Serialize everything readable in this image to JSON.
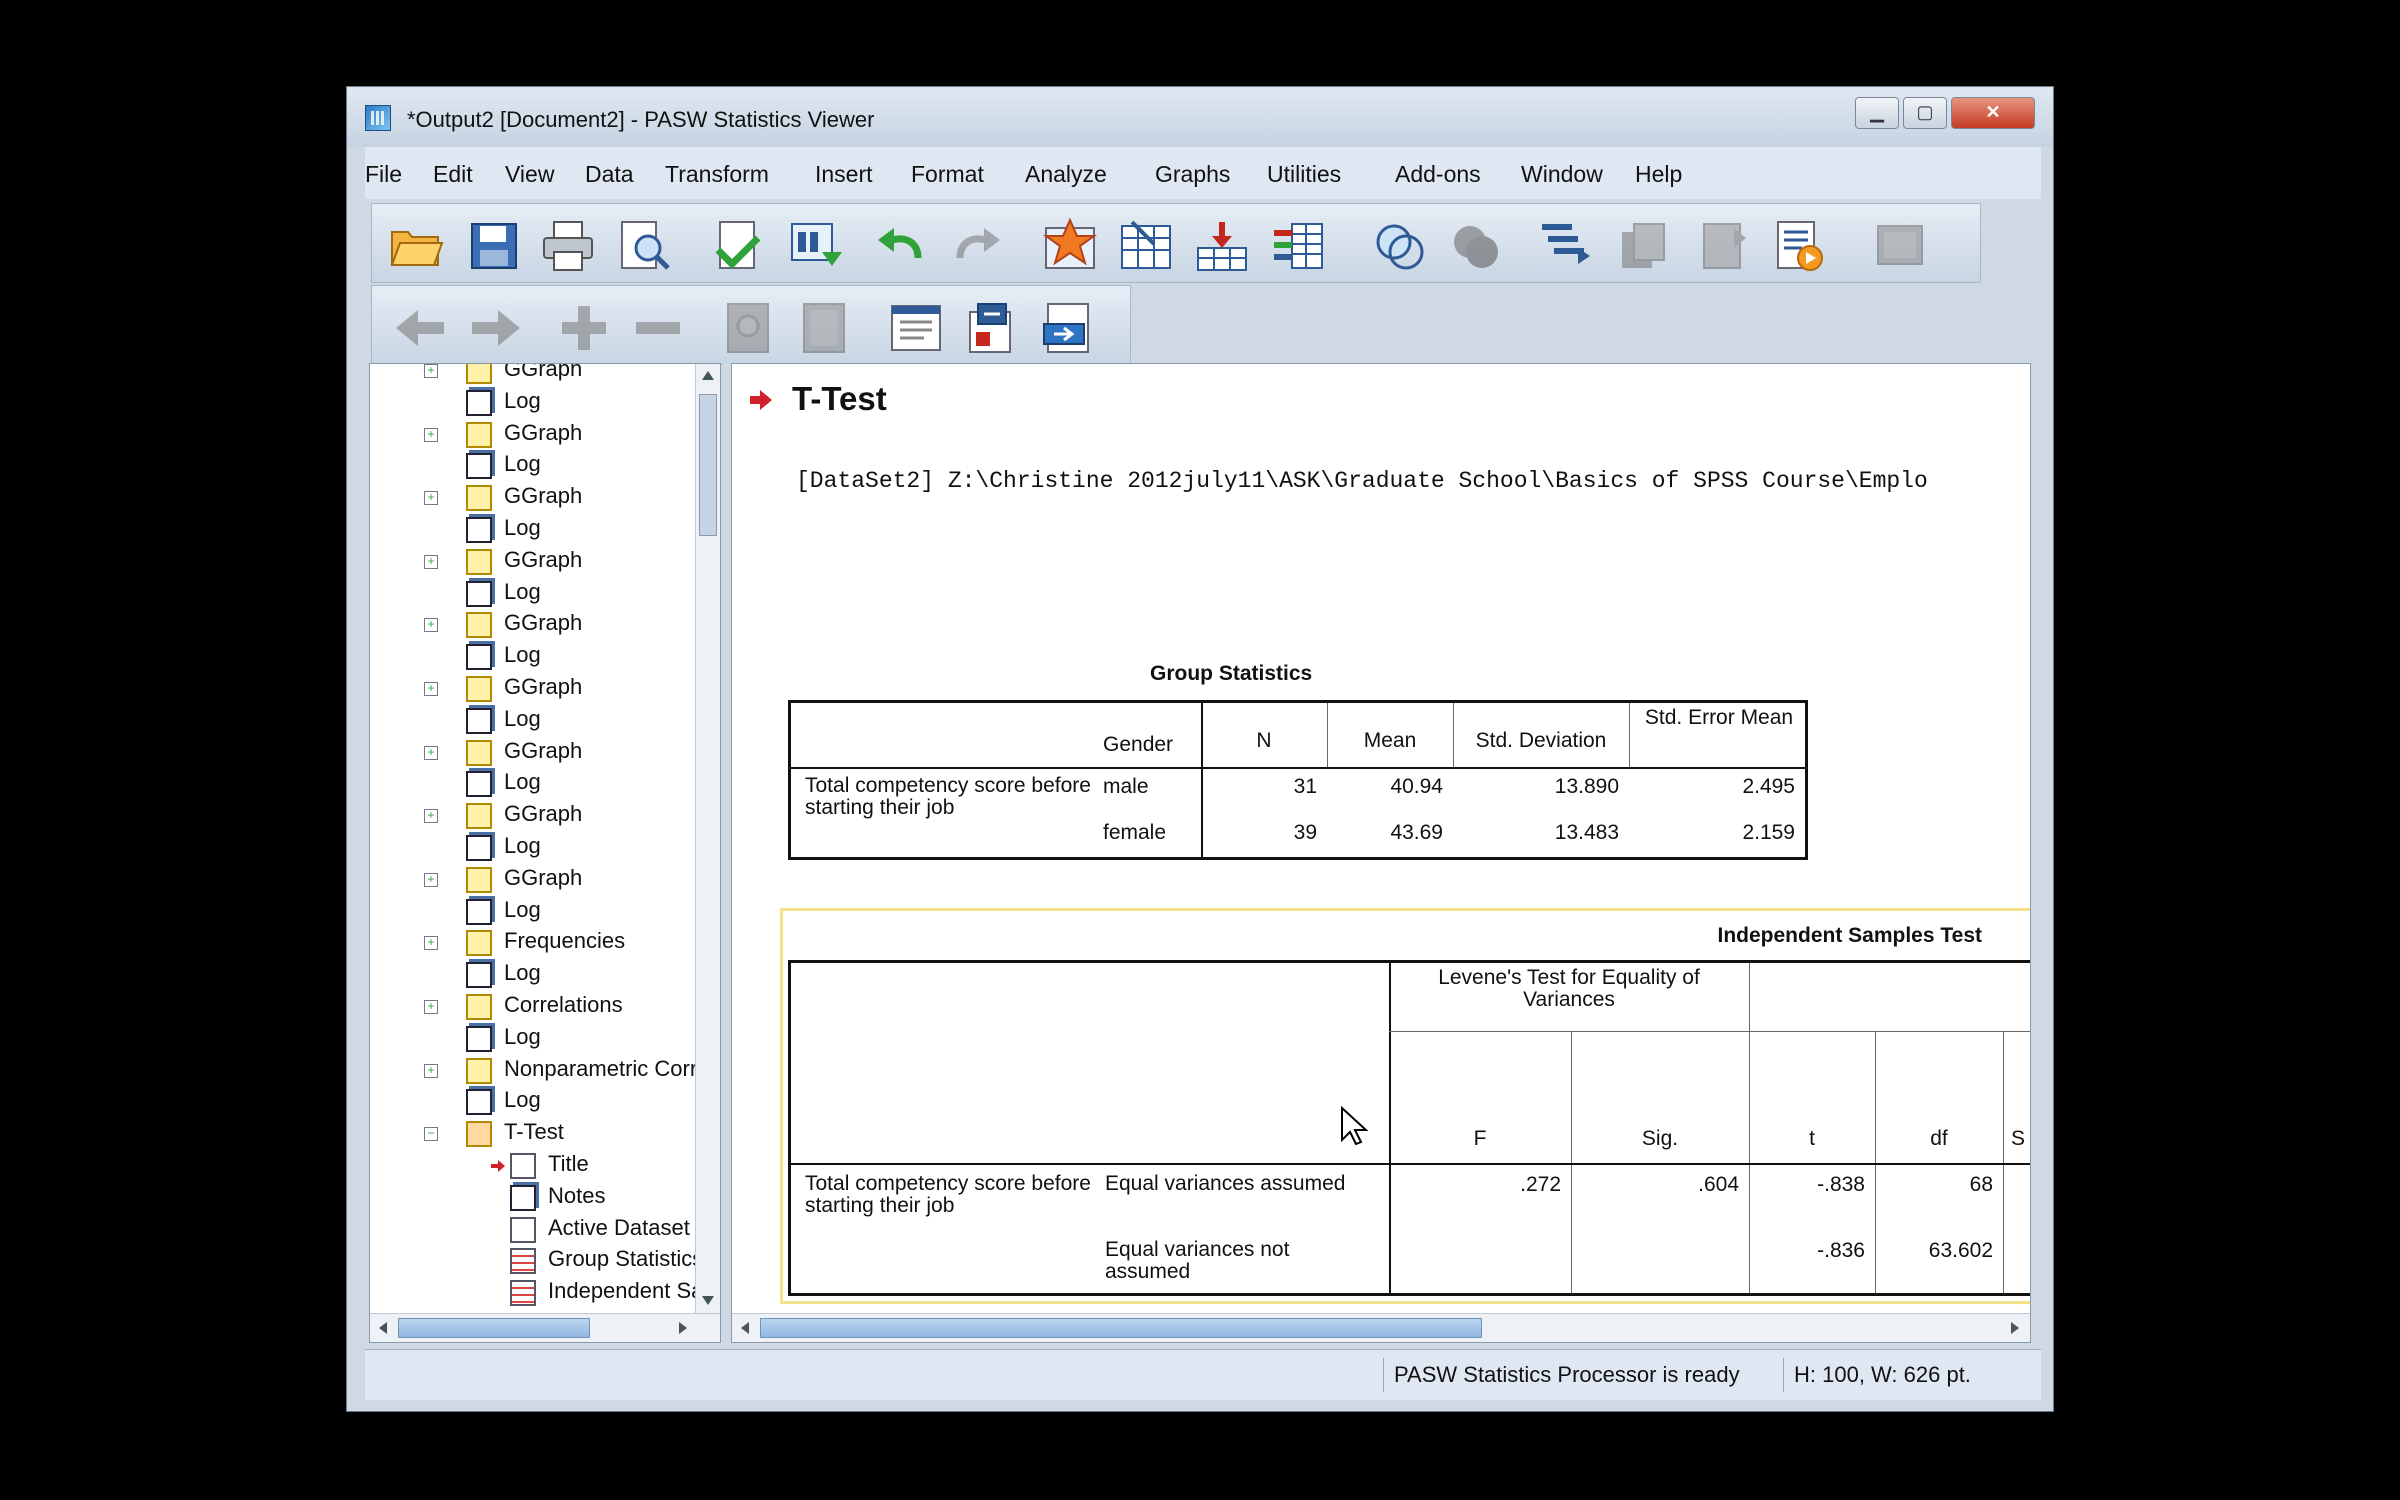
{
  "window": {
    "title": "*Output2 [Document2] - PASW Statistics Viewer"
  },
  "titlebar_buttons": {
    "minimize": "▁",
    "maximize": "▢",
    "close": "✕"
  },
  "menu": [
    "File",
    "Edit",
    "View",
    "Data",
    "Transform",
    "Insert",
    "Format",
    "Analyze",
    "Graphs",
    "Utilities",
    "Add-ons",
    "Window",
    "Help"
  ],
  "toolbar1_icons": [
    "open-icon",
    "save-icon",
    "print-icon",
    "print-preview-icon",
    "export-icon",
    "recall-dialog-icon",
    "undo-icon",
    "redo-icon",
    "goto-case-icon",
    "goto-variable-icon",
    "insert-cases-icon",
    "variables-icon",
    "select-cases-icon",
    "weight-cases-icon",
    "split-file-icon",
    "value-labels-icon",
    "use-sets-icon",
    "show-all-variables-icon",
    "spelling-icon"
  ],
  "toolbar2_icons": [
    "promote-icon",
    "demote-icon",
    "expand-icon",
    "collapse-icon",
    "show-icon",
    "hide-icon",
    "insert-heading-icon",
    "insert-title-icon",
    "insert-text-icon"
  ],
  "outline": [
    {
      "label": "GGraph",
      "type": "folder",
      "expand": true
    },
    {
      "label": "Log",
      "type": "log"
    },
    {
      "label": "GGraph",
      "type": "folder",
      "expand": true
    },
    {
      "label": "Log",
      "type": "log"
    },
    {
      "label": "GGraph",
      "type": "folder",
      "expand": true
    },
    {
      "label": "Log",
      "type": "log"
    },
    {
      "label": "GGraph",
      "type": "folder",
      "expand": true
    },
    {
      "label": "Log",
      "type": "log"
    },
    {
      "label": "GGraph",
      "type": "folder",
      "expand": true
    },
    {
      "label": "Log",
      "type": "log"
    },
    {
      "label": "GGraph",
      "type": "folder",
      "expand": true
    },
    {
      "label": "Log",
      "type": "log"
    },
    {
      "label": "GGraph",
      "type": "folder",
      "expand": true
    },
    {
      "label": "Log",
      "type": "log"
    },
    {
      "label": "GGraph",
      "type": "folder",
      "expand": true
    },
    {
      "label": "Log",
      "type": "log"
    },
    {
      "label": "GGraph",
      "type": "folder",
      "expand": true
    },
    {
      "label": "Log",
      "type": "log"
    },
    {
      "label": "Frequencies",
      "type": "folder",
      "expand": true
    },
    {
      "label": "Log",
      "type": "log"
    },
    {
      "label": "Correlations",
      "type": "folder",
      "expand": true
    },
    {
      "label": "Log",
      "type": "log"
    },
    {
      "label": "Nonparametric Corr",
      "type": "folder",
      "expand": true
    },
    {
      "label": "Log",
      "type": "log"
    },
    {
      "label": "T-Test",
      "type": "folder-open",
      "expand": false
    },
    {
      "label": "Title",
      "type": "title",
      "child": true,
      "current": true
    },
    {
      "label": "Notes",
      "type": "log",
      "child": true
    },
    {
      "label": "Active Dataset",
      "type": "title",
      "child": true
    },
    {
      "label": "Group Statistics",
      "type": "table",
      "child": true
    },
    {
      "label": "Independent Sa",
      "type": "table",
      "child": true
    }
  ],
  "content": {
    "heading": "T-Test",
    "dataset_line": "[DataSet2] Z:\\Christine 2012july11\\ASK\\Graduate School\\Basics of SPSS Course\\Emplo",
    "group_stats": {
      "title": "Group Statistics",
      "headers": [
        "Gender",
        "N",
        "Mean",
        "Std. Deviation",
        "Std. Error Mean"
      ],
      "row_label": "Total competency score before starting their job",
      "rows": [
        {
          "gender": "male",
          "n": "31",
          "mean": "40.94",
          "sd": "13.890",
          "se": "2.495"
        },
        {
          "gender": "female",
          "n": "39",
          "mean": "43.69",
          "sd": "13.483",
          "se": "2.159"
        }
      ]
    },
    "ind_test": {
      "title": "Independent Samples Test",
      "levene_header": "Levene's Test for Equality of Variances",
      "headers": [
        "F",
        "Sig.",
        "t",
        "df",
        "S"
      ],
      "row_label": "Total competency score before starting their job",
      "rows": [
        {
          "label": "Equal variances assumed",
          "f": ".272",
          "sig": ".604",
          "t": "-.838",
          "df": "68"
        },
        {
          "label": "Equal variances not assumed",
          "f": "",
          "sig": "",
          "t": "-.836",
          "df": "63.602"
        }
      ]
    }
  },
  "status": {
    "message": "PASW Statistics Processor is ready",
    "dims": "H: 100, W: 626 pt."
  },
  "colors": {
    "accent_arrow": "#d0202a",
    "selection_border": "#f2e28a"
  }
}
